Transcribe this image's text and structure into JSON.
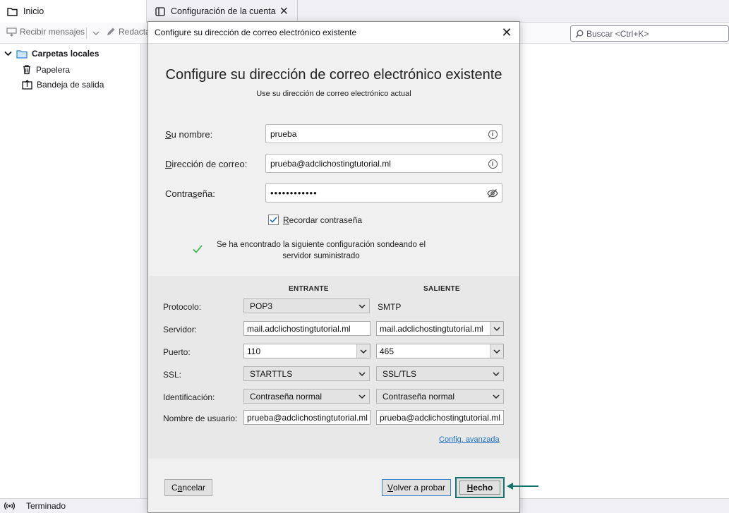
{
  "tabs": {
    "home_label": "Inicio",
    "account_label": "Configuración de la cuenta"
  },
  "toolbar": {
    "receive_label": "Recibir mensajes",
    "compose_label": "Redacta",
    "search_placeholder": "Buscar <Ctrl+K>"
  },
  "folders": {
    "root_label": "Carpetas locales",
    "items": [
      {
        "label": "Papelera",
        "icon": "trash-icon"
      },
      {
        "label": "Bandeja de salida",
        "icon": "outbox-icon"
      }
    ]
  },
  "status": {
    "text": "Terminado"
  },
  "dialog": {
    "title": "Configure su dirección de correo electrónico existente",
    "heading": "Configure su dirección de correo electrónico existente",
    "subheading": "Use su dirección de correo electrónico actual",
    "name_label_accesskey": "S",
    "name_label_rest": "u nombre:",
    "name_value": "prueba",
    "email_label_prefix": "",
    "email_label_accesskey": "D",
    "email_label_rest": "irección de correo:",
    "email_value": "prueba@adclichostingtutorial.ml",
    "password_label_prefix": "Contra",
    "password_label_accesskey": "s",
    "password_label_rest": "eña:",
    "password_value": "••••••••••••",
    "remember_accesskey": "R",
    "remember_rest": "ecordar contraseña",
    "remember_checked": true,
    "success_message": "Se ha encontrado la siguiente configuración sondeando el servidor suministrado",
    "server": {
      "incoming_header": "ENTRANTE",
      "outgoing_header": "SALIENTE",
      "rows": {
        "protocol_label": "Protocolo:",
        "server_label": "Servidor:",
        "port_label": "Puerto:",
        "ssl_label": "SSL:",
        "auth_label": "Identificación:",
        "username_label": "Nombre de usuario:"
      },
      "incoming": {
        "protocol": "POP3",
        "server": "mail.adclichostingtutorial.ml",
        "port": "110",
        "ssl": "STARTTLS",
        "auth": "Contraseña normal",
        "username": "prueba@adclichostingtutorial.ml"
      },
      "outgoing": {
        "protocol": "SMTP",
        "server": "mail.adclichostingtutorial.ml",
        "port": "465",
        "ssl": "SSL/TLS",
        "auth": "Contraseña normal",
        "username": "prueba@adclichostingtutorial.ml"
      }
    },
    "advanced_link": "Config. avanzada",
    "cancel_accesskey": "a",
    "cancel_prefix": "C",
    "cancel_rest": "ncelar",
    "retry_accesskey": "V",
    "retry_rest": "olver a probar",
    "done_accesskey": "H",
    "done_rest": "echo"
  },
  "colors": {
    "accent_link": "#1f6fc5",
    "done_highlight": "#13746d",
    "success_check": "#2fb344"
  }
}
